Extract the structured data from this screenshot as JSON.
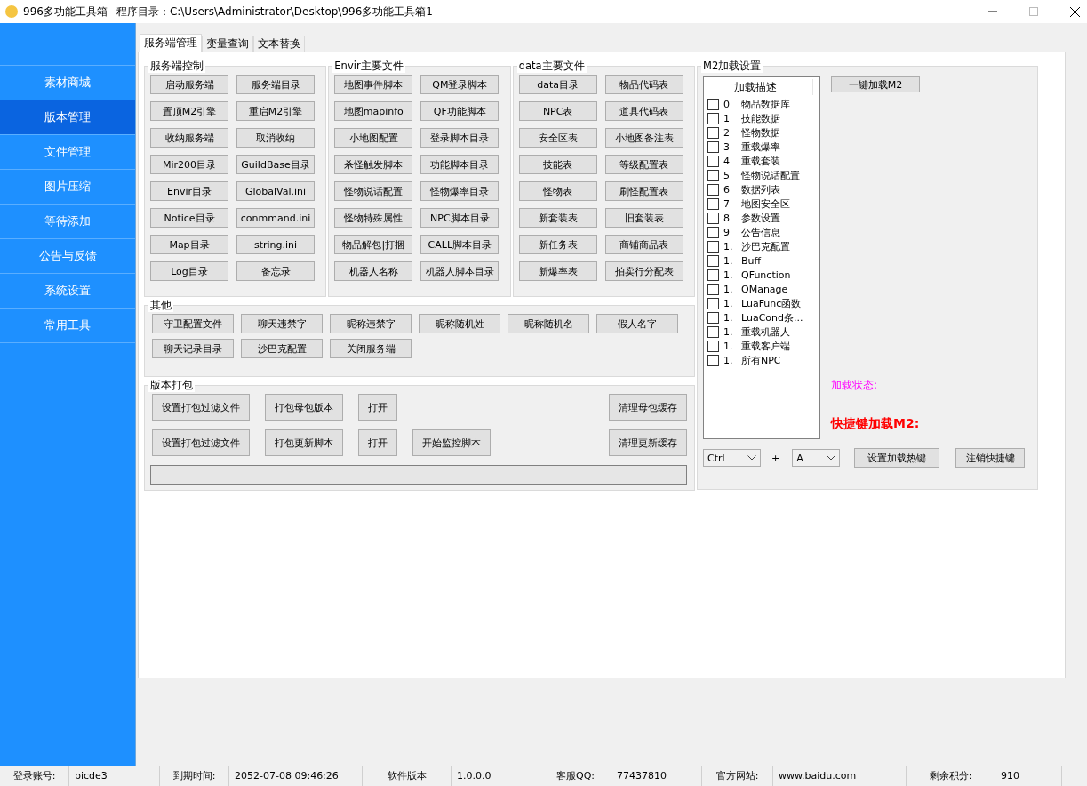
{
  "window": {
    "title": "996多功能工具箱",
    "path_label": "程序目录：C:\\Users\\Administrator\\Desktop\\996多功能工具箱1"
  },
  "sidebar": {
    "items": [
      {
        "label": "素材商城",
        "selected": false
      },
      {
        "label": "版本管理",
        "selected": true
      },
      {
        "label": "文件管理",
        "selected": false
      },
      {
        "label": "图片压缩",
        "selected": false
      },
      {
        "label": "等待添加",
        "selected": false
      },
      {
        "label": "公告与反馈",
        "selected": false
      },
      {
        "label": "系统设置",
        "selected": false
      },
      {
        "label": "常用工具",
        "selected": false
      }
    ]
  },
  "tabs": [
    {
      "label": "服务端管理",
      "selected": true
    },
    {
      "label": "变量查询",
      "selected": false
    },
    {
      "label": "文本替换",
      "selected": false
    }
  ],
  "server_control": {
    "title": "服务端控制",
    "buttons": [
      "启动服务端",
      "服务端目录",
      "置顶M2引擎",
      "重启M2引擎",
      "收纳服务端",
      "取消收纳",
      "Mir200目录",
      "GuildBase目录",
      "Envir目录",
      "GlobalVal.ini",
      "Notice目录",
      "conmmand.ini",
      "Map目录",
      "string.ini",
      "Log目录",
      "备忘录"
    ]
  },
  "envir_files": {
    "title": "Envir主要文件",
    "buttons": [
      "地图事件脚本",
      "QM登录脚本",
      "地图mapinfo",
      "QF功能脚本",
      "小地图配置",
      "登录脚本目录",
      "杀怪触发脚本",
      "功能脚本目录",
      "怪物说话配置",
      "怪物爆率目录",
      "怪物特殊属性",
      "NPC脚本目录",
      "物品解包|打捆",
      "CALL脚本目录",
      "机器人名称",
      "机器人脚本目录"
    ]
  },
  "data_files": {
    "title": "data主要文件",
    "buttons": [
      "data目录",
      "物品代码表",
      "NPC表",
      "道具代码表",
      "安全区表",
      "小地图备注表",
      "技能表",
      "等级配置表",
      "怪物表",
      "刷怪配置表",
      "新套装表",
      "旧套装表",
      "新任务表",
      "商铺商品表",
      "新爆率表",
      "拍卖行分配表"
    ]
  },
  "other": {
    "title": "其他",
    "buttons": [
      "守卫配置文件",
      "聊天违禁字",
      "昵称违禁字",
      "昵称随机姓",
      "昵称随机名",
      "假人名字",
      "聊天记录目录",
      "沙巴克配置",
      "关闭服务端"
    ]
  },
  "packaging": {
    "title": "版本打包",
    "rows": [
      {
        "buttons": [
          "设置打包过滤文件",
          "打包母包版本",
          "打开"
        ],
        "right_button": "清理母包缓存"
      },
      {
        "buttons": [
          "设置打包过滤文件",
          "打包更新脚本",
          "打开",
          "开始监控脚本"
        ],
        "right_button": "清理更新缓存"
      }
    ],
    "progress": {
      "level": 0
    }
  },
  "m2_loading": {
    "title": "M2加载设置",
    "list_header": "加载描述",
    "items": [
      {
        "index": "0",
        "label": "物品数据库",
        "checked": false
      },
      {
        "index": "1",
        "label": "技能数据",
        "checked": false
      },
      {
        "index": "2",
        "label": "怪物数据",
        "checked": false
      },
      {
        "index": "3",
        "label": "重载爆率",
        "checked": false
      },
      {
        "index": "4",
        "label": "重载套装",
        "checked": false
      },
      {
        "index": "5",
        "label": "怪物说话配置",
        "checked": false
      },
      {
        "index": "6",
        "label": "数据列表",
        "checked": false
      },
      {
        "index": "7",
        "label": "地图安全区",
        "checked": false
      },
      {
        "index": "8",
        "label": "参数设置",
        "checked": false
      },
      {
        "index": "9",
        "label": "公告信息",
        "checked": false
      },
      {
        "index": "1.",
        "label": "沙巴克配置",
        "checked": false
      },
      {
        "index": "1.",
        "label": "Buff",
        "checked": false
      },
      {
        "index": "1.",
        "label": "QFunction",
        "checked": false
      },
      {
        "index": "1.",
        "label": "QManage",
        "checked": false
      },
      {
        "index": "1.",
        "label": "LuaFunc函数",
        "checked": false
      },
      {
        "index": "1.",
        "label": "LuaCond条...",
        "checked": false
      },
      {
        "index": "1.",
        "label": "重载机器人",
        "checked": false
      },
      {
        "index": "1.",
        "label": "重载客户端",
        "checked": false
      },
      {
        "index": "1.",
        "label": "所有NPC",
        "checked": false
      }
    ],
    "load_button": "一键加载M2",
    "status_label": "加载状态:",
    "hotkey_label": "快捷键加载M2:",
    "modifier": "Ctrl",
    "plus": "+",
    "key": "A",
    "set_button": "设置加载热键",
    "cancel_button": "注销快捷键"
  },
  "status_bar": [
    {
      "label": "登录账号:",
      "value": "bicde3"
    },
    {
      "label": "到期时间:",
      "value": "2052-07-08 09:46:26"
    },
    {
      "label": "软件版本",
      "value": "1.0.0.0"
    },
    {
      "label": "客服QQ:",
      "value": "77437810"
    },
    {
      "label": "官方网站:",
      "value": "www.baidu.com"
    },
    {
      "label": "剩余积分:",
      "value": "910"
    }
  ]
}
